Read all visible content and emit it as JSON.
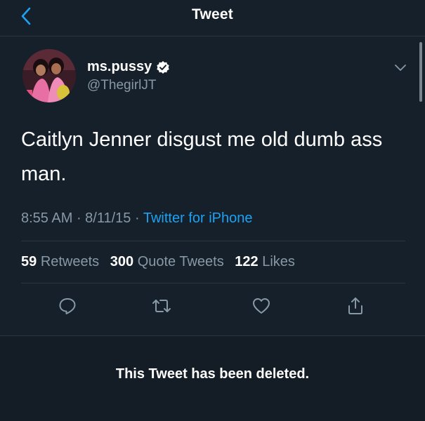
{
  "header": {
    "title": "Tweet",
    "back_icon": "chevron-left-icon",
    "accent": "#1da1f2"
  },
  "tweet": {
    "display_name": "ms.pussy",
    "handle": "@ThegirlJT",
    "verified": true,
    "text": "Caitlyn Jenner disgust me old dumb ass man.",
    "time": "8:55 AM",
    "date": "8/11/15",
    "source": "Twitter for iPhone"
  },
  "stats": {
    "retweets": {
      "count": "59",
      "label": "Retweets"
    },
    "quote_tweets": {
      "count": "300",
      "label": "Quote Tweets"
    },
    "likes": {
      "count": "122",
      "label": "Likes"
    }
  },
  "actions": [
    "reply-icon",
    "retweet-icon",
    "like-icon",
    "share-icon"
  ],
  "notice": {
    "text": "This Tweet has been deleted."
  },
  "colors": {
    "background": "#15202b",
    "text": "#ffffff",
    "secondary": "#8899a6",
    "link": "#1da1f2",
    "divider": "#2c3640"
  }
}
